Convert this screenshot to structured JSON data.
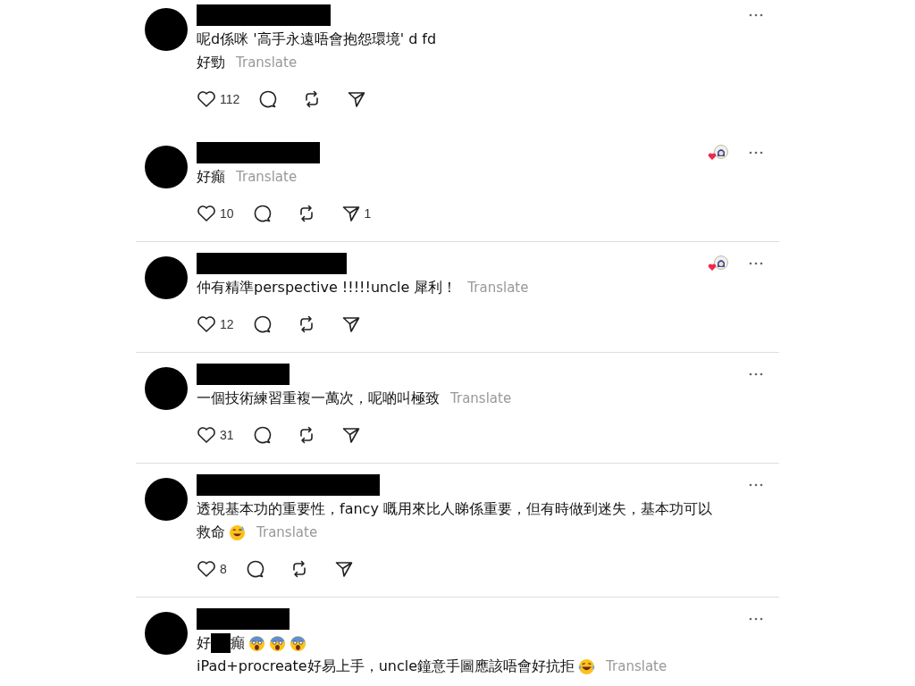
{
  "posts": [
    {
      "separated": false,
      "liked_by_author": false,
      "lines": [
        [
          {
            "kind": "text",
            "text": "呢d係咪 '高手永遠唔會抱怨環境' d fd"
          }
        ],
        [
          {
            "kind": "text",
            "text": "好勁"
          }
        ]
      ],
      "translate": "Translate",
      "likes": "112"
    },
    {
      "separated": false,
      "liked_by_author": true,
      "lines": [
        [
          {
            "kind": "text",
            "text": "好癲"
          }
        ]
      ],
      "translate": "Translate",
      "likes": "10",
      "shares": "1"
    },
    {
      "separated": true,
      "liked_by_author": true,
      "lines": [
        [
          {
            "kind": "text",
            "text": "仲有精準perspective !!!!!uncle 犀利！"
          }
        ]
      ],
      "translate": "Translate",
      "likes": "12"
    },
    {
      "separated": true,
      "liked_by_author": false,
      "lines": [
        [
          {
            "kind": "text",
            "text": "一個技術練習重複一萬次，呢啲叫極致"
          }
        ]
      ],
      "translate": "Translate",
      "likes": "31"
    },
    {
      "separated": true,
      "liked_by_author": false,
      "lines": [
        [
          {
            "kind": "text",
            "text": "透視基本功的重要性，fancy 嘅用來比人睇係重要，但有時做到迷失，基本功可以"
          }
        ],
        [
          {
            "kind": "text",
            "text": "救命"
          },
          {
            "kind": "sweat"
          }
        ]
      ],
      "translate": "Translate",
      "likes": "8"
    },
    {
      "separated": true,
      "liked_by_author": false,
      "lines": [
        [
          {
            "kind": "text",
            "text": "好"
          },
          {
            "kind": "redacted"
          },
          {
            "kind": "text",
            "text": "癲"
          },
          {
            "kind": "scream"
          },
          {
            "kind": "scream"
          },
          {
            "kind": "scream"
          }
        ],
        [
          {
            "kind": "text",
            "text": "iPad+procreate好易上手，uncle鐘意手圖應該唔會好抗拒"
          },
          {
            "kind": "laugh"
          }
        ]
      ],
      "translate": "Translate"
    }
  ]
}
